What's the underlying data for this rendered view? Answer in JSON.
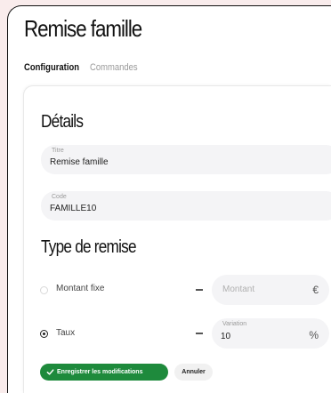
{
  "page": {
    "title": "Remise famille"
  },
  "tabs": [
    {
      "label": "Configuration",
      "active": true
    },
    {
      "label": "Commandes",
      "active": false
    }
  ],
  "details": {
    "heading": "Détails",
    "titre": {
      "label": "Titre",
      "value": "Remise famille"
    },
    "code": {
      "label": "Code",
      "value": "FAMILLE10"
    }
  },
  "discount_type": {
    "heading": "Type de remise",
    "fixed": {
      "label": "Montant fixe",
      "selected": false,
      "placeholder": "Montant",
      "unit": "€"
    },
    "rate": {
      "label": "Taux",
      "selected": true,
      "field_label": "Variation",
      "value": "10",
      "unit": "%"
    }
  },
  "actions": {
    "save_label": "Enregistrer les modifications",
    "cancel_label": "Annuler"
  },
  "colors": {
    "background": "#f9ecec",
    "primary_button": "#1e8a3c",
    "field_background": "#f4f4f6"
  },
  "icons": {
    "save": "check-icon",
    "radio_on": "radio-selected",
    "radio_off": "radio-unselected"
  }
}
